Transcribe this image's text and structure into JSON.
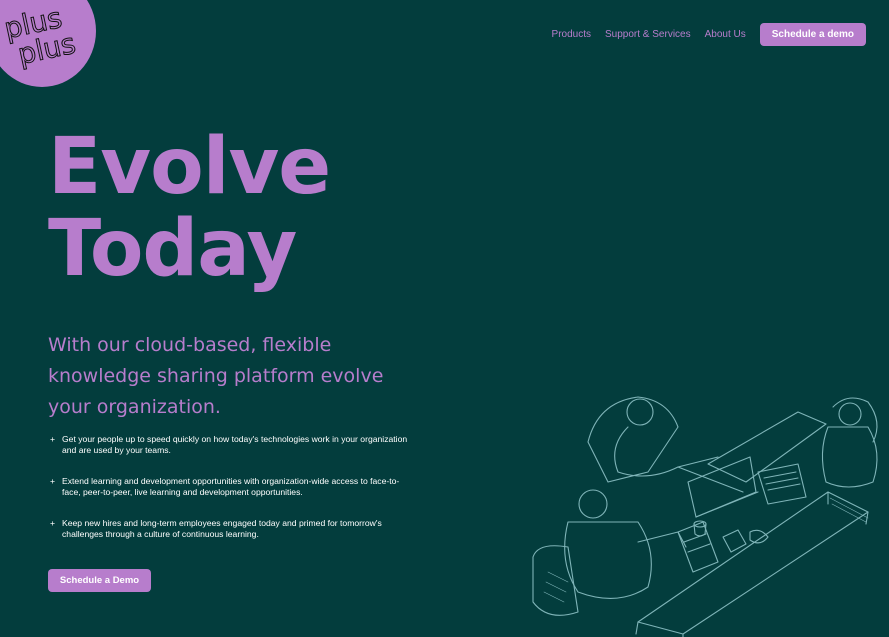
{
  "brand": {
    "logo_text": [
      "plus",
      "plus"
    ],
    "accent": "#b77dcc",
    "background": "#033d3d"
  },
  "nav": {
    "items": [
      "Products",
      "Support & Services",
      "About Us"
    ],
    "cta": "Schedule a demo"
  },
  "hero": {
    "headline": [
      "Evolve",
      "Today"
    ],
    "subhead": "With our cloud-based, flexible knowledge sharing platform evolve your organization.",
    "bullets": [
      "Get your people up to speed quickly on how today's technologies work in your organization and are used by your teams.",
      "Extend learning and development opportunities with organization-wide access to face-to-face, peer-to-peer, live learning and development opportunities.",
      "Keep new hires and long-term employees engaged today and primed for tomorrow's challenges through a culture of continuous learning."
    ],
    "bullet_marker": "+",
    "cta": "Schedule a Demo"
  }
}
